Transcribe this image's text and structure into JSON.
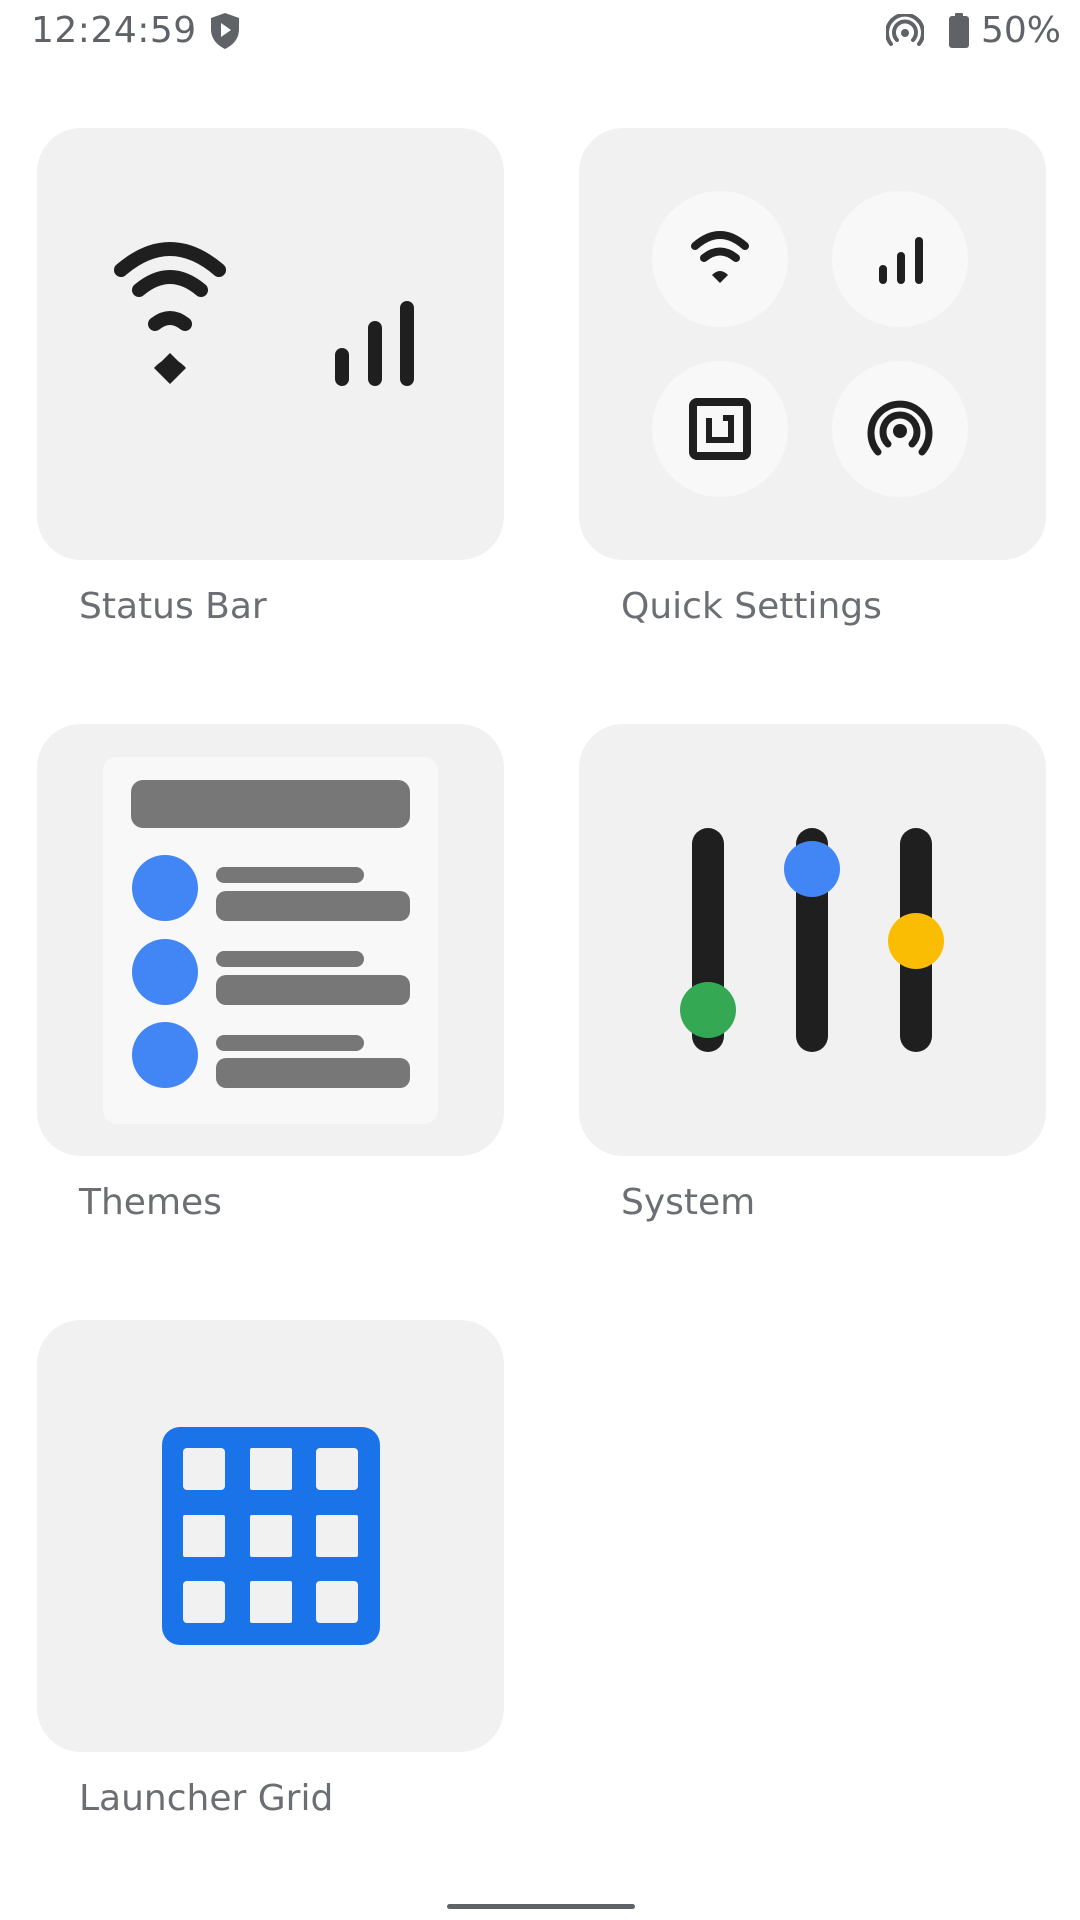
{
  "status_bar": {
    "time": "12:24:59",
    "battery_percent": "50%",
    "icons": [
      "shield-play-icon",
      "hotspot-icon",
      "battery-icon"
    ]
  },
  "tiles": [
    {
      "label": "Status Bar",
      "icon": "wifi-and-cellular-icons"
    },
    {
      "label": "Quick Settings",
      "icon": "quick-settings-toggles-icon"
    },
    {
      "label": "Themes",
      "icon": "theme-preview-icon"
    },
    {
      "label": "System",
      "icon": "sliders-icon"
    },
    {
      "label": "Launcher Grid",
      "icon": "grid-icon"
    }
  ],
  "colors": {
    "tile_background": "#f1f1f1",
    "icon_dark": "#1f1f1f",
    "accent_blue": "#4285f4",
    "grid_blue": "#1a73e8",
    "green": "#34a853",
    "yellow": "#fbbc04",
    "placeholder_gray": "#777777"
  }
}
